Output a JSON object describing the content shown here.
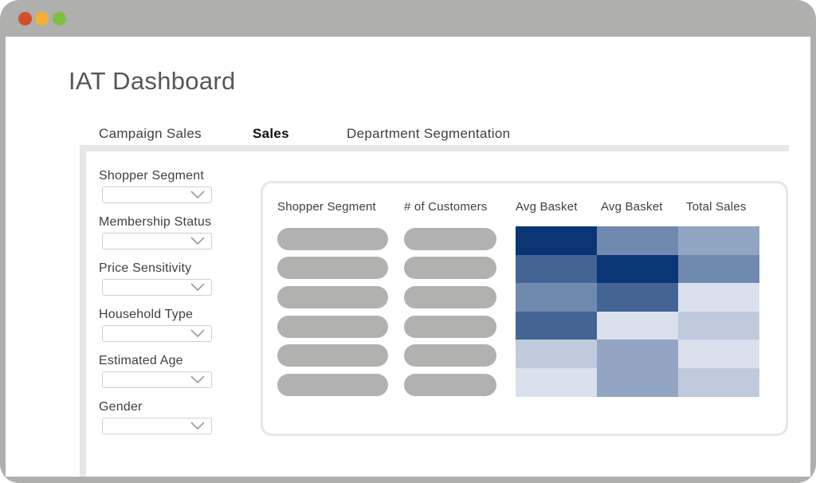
{
  "app": {
    "title": "IAT Dashboard"
  },
  "tabs": [
    {
      "label": "Campaign Sales",
      "active": false
    },
    {
      "label": "Sales",
      "active": true
    },
    {
      "label": "Department Segmentation",
      "active": false
    }
  ],
  "filters": [
    {
      "label": "Shopper Segment",
      "value": ""
    },
    {
      "label": "Membership Status",
      "value": ""
    },
    {
      "label": "Price Sensitivity",
      "value": ""
    },
    {
      "label": "Household Type",
      "value": ""
    },
    {
      "label": "Estimated Age",
      "value": ""
    },
    {
      "label": "Gender",
      "value": ""
    }
  ],
  "table": {
    "headers": [
      "Shopper Segment",
      "# of Customers",
      "Avg Basket",
      "Avg Basket",
      "Total Sales"
    ],
    "heatmap_levels": [
      [
        1.0,
        0.55,
        0.4
      ],
      [
        0.75,
        1.0,
        0.55
      ],
      [
        0.55,
        0.75,
        0.08
      ],
      [
        0.75,
        0.08,
        0.2
      ],
      [
        0.2,
        0.4,
        0.08
      ],
      [
        0.08,
        0.4,
        0.2
      ]
    ]
  },
  "colors": {
    "window_frame": "#afafae",
    "traffic_red": "#d24f27",
    "traffic_yellow": "#f2b134",
    "traffic_green": "#7dc143",
    "heat_dark": "#0b3675",
    "heat_light": "#eceff6"
  }
}
